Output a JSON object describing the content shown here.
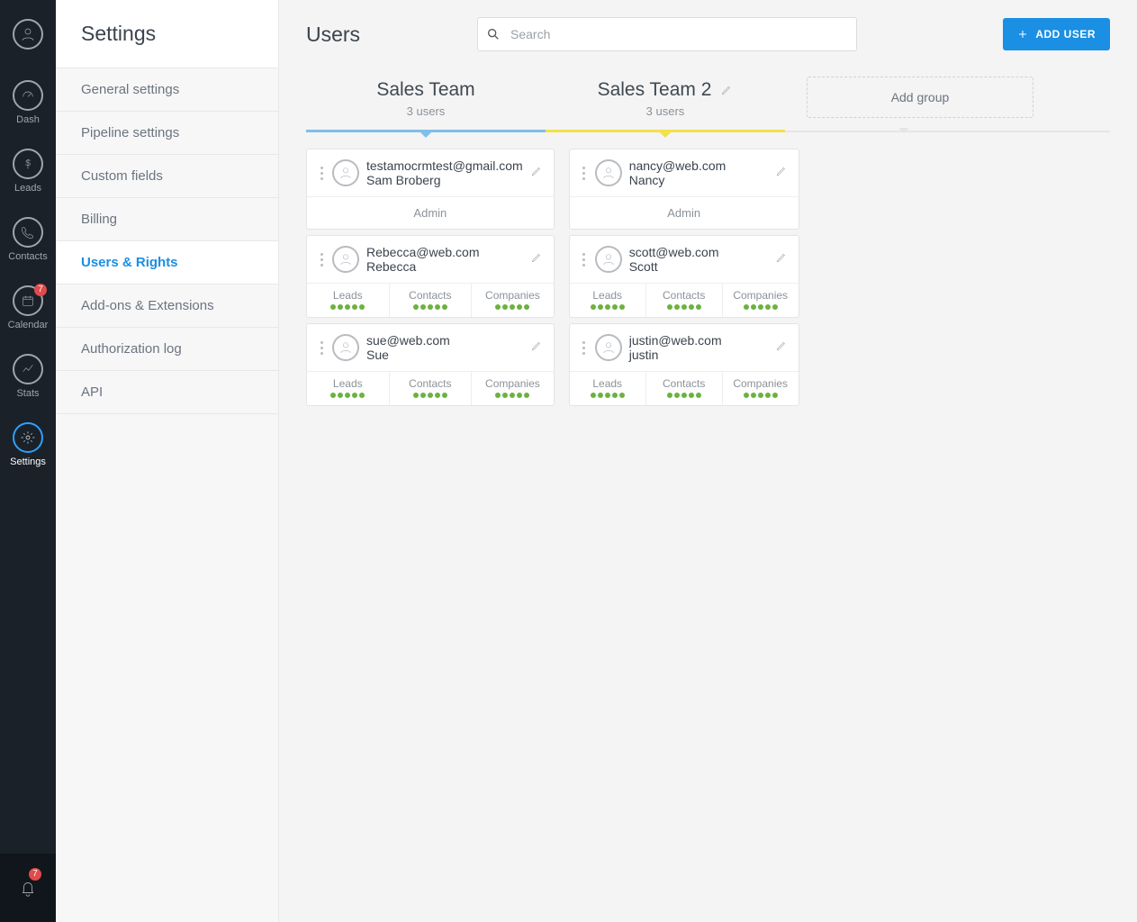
{
  "rail": {
    "items": [
      {
        "label": "Dash"
      },
      {
        "label": "Leads"
      },
      {
        "label": "Contacts"
      },
      {
        "label": "Calendar",
        "badge": "7"
      },
      {
        "label": "Stats"
      },
      {
        "label": "Settings"
      }
    ],
    "notif_badge": "7"
  },
  "sidebar": {
    "title": "Settings",
    "items": [
      {
        "label": "General settings"
      },
      {
        "label": "Pipeline settings"
      },
      {
        "label": "Custom fields"
      },
      {
        "label": "Billing"
      },
      {
        "label": "Users & Rights"
      },
      {
        "label": "Add-ons & Extensions"
      },
      {
        "label": "Authorization log"
      },
      {
        "label": "API"
      }
    ]
  },
  "header": {
    "title": "Users",
    "search_placeholder": "Search",
    "add_user": "ADD USER"
  },
  "groups": [
    {
      "name": "Sales Team",
      "count": "3 users"
    },
    {
      "name": "Sales Team 2",
      "count": "3 users"
    }
  ],
  "add_group": "Add group",
  "perm_labels": {
    "leads": "Leads",
    "contacts": "Contacts",
    "companies": "Companies"
  },
  "admin_label": "Admin",
  "columns": [
    [
      {
        "email": "testamocrmtest@gmail.com",
        "name": "Sam Broberg",
        "admin": true
      },
      {
        "email": "Rebecca@web.com",
        "name": "Rebecca",
        "admin": false
      },
      {
        "email": "sue@web.com",
        "name": "Sue",
        "admin": false
      }
    ],
    [
      {
        "email": "nancy@web.com",
        "name": "Nancy",
        "admin": true
      },
      {
        "email": "scott@web.com",
        "name": "Scott",
        "admin": false
      },
      {
        "email": "justin@web.com",
        "name": "justin",
        "admin": false
      }
    ]
  ]
}
